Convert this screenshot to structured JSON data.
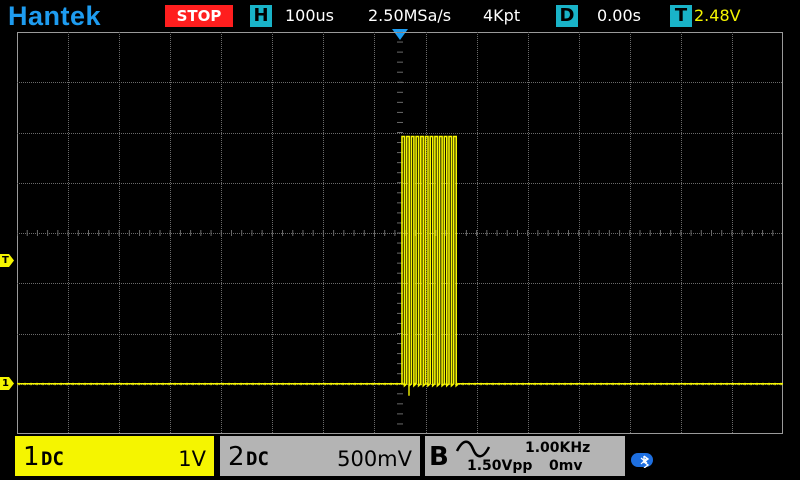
{
  "header": {
    "brand": "Hantek",
    "run_state": "STOP",
    "horizontal": {
      "badge": "H",
      "timebase": "100us",
      "sample_rate": "2.50MSa/s",
      "memory_depth": "4Kpt"
    },
    "delay": {
      "badge": "D",
      "value": "0.00s"
    },
    "trigger": {
      "badge": "T",
      "level": "2.48V"
    }
  },
  "screen": {
    "trigger_level_marker": "T",
    "ch1_ground_marker": "1",
    "colors": {
      "trace": "#f5f500",
      "grid": "#6a6a6a",
      "trigger_marker": "#1e9cf0"
    },
    "grid_divisions": {
      "horizontal": 15,
      "vertical": 8
    },
    "trace_description": "channel 1 low near -3 div, burst of ~12 narrow pulses to +2 div starting at trigger point"
  },
  "channels": {
    "ch1": {
      "number": "1",
      "coupling": "DC",
      "scale": "1V",
      "color": "#f5f500"
    },
    "ch2": {
      "number": "2",
      "coupling": "DC",
      "scale": "500mV",
      "color": "#b4b4b4"
    },
    "generator": {
      "label": "B",
      "frequency": "1.00KHz",
      "amplitude": "1.50Vpp",
      "offset": "0mv"
    }
  },
  "status_icons": [
    "bluetooth-icon"
  ]
}
